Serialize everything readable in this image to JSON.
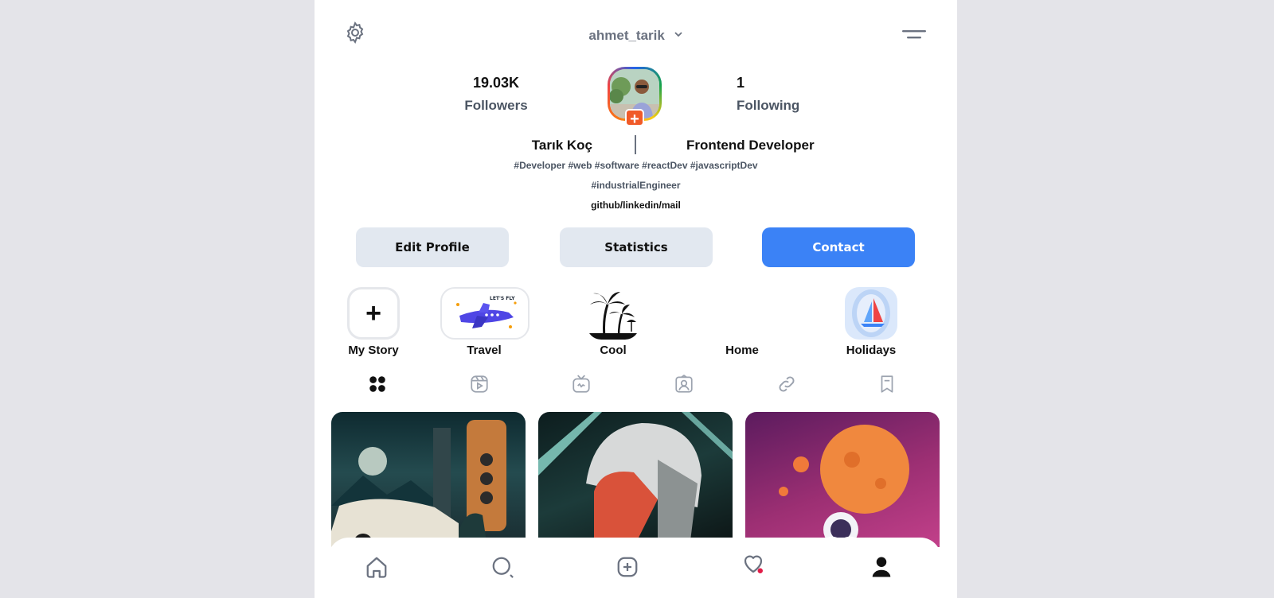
{
  "header": {
    "username": "ahmet_tarik"
  },
  "stats": {
    "followers_count": "19.03K",
    "followers_label": "Followers",
    "following_count": "1",
    "following_label": "Following"
  },
  "profile": {
    "full_name": "Tarık Koç",
    "title": "Frontend Developer",
    "tags_line1": "#Developer #web #software #reactDev #javascriptDev",
    "tags_line2": "#industrialEngineer",
    "links": "github/linkedin/mail"
  },
  "actions": {
    "edit_profile": "Edit Profile",
    "statistics": "Statistics",
    "contact": "Contact"
  },
  "stories": [
    {
      "label": "My Story"
    },
    {
      "label": "Travel"
    },
    {
      "label": "Cool"
    },
    {
      "label": "Home"
    },
    {
      "label": "Holidays"
    }
  ],
  "colors": {
    "accent": "#3b82f6",
    "secondary_button": "#e2e8f0",
    "notification_dot": "#e11d48"
  },
  "icons": {
    "tabs": [
      "grid-icon",
      "reels-icon",
      "igtv-icon",
      "tagged-icon",
      "link-icon",
      "bookmark-icon"
    ],
    "nav": [
      "home-icon",
      "search-icon",
      "add-icon",
      "heart-icon",
      "profile-icon"
    ]
  }
}
